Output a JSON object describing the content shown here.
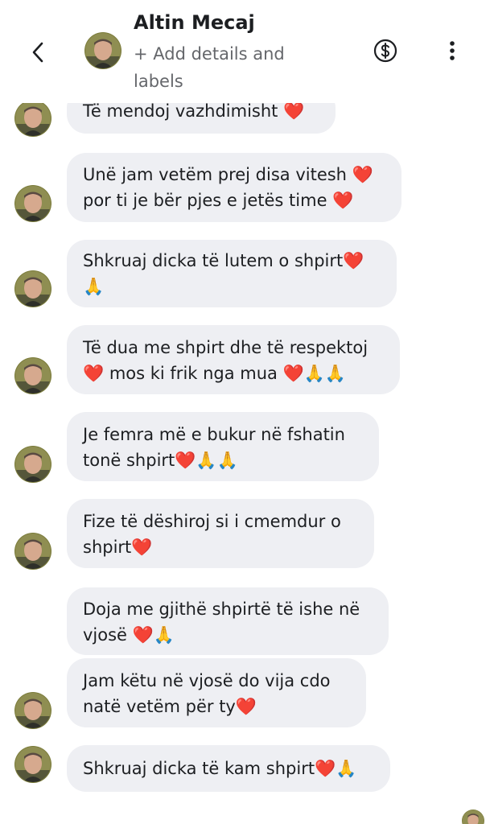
{
  "header": {
    "contact_name": "Altin Mecaj",
    "subtitle": "+ Add details and labels"
  },
  "icons": {
    "back": "chevron-left-icon",
    "payment": "dollar-circle-icon",
    "more": "vertical-ellipsis-icon"
  },
  "messages": [
    {
      "text": "Të mendoj vazhdimisht ❤️"
    },
    {
      "text": "Unë jam vetëm prej disa vitesh ❤️ por ti je bër pjes e jetës time ❤️"
    },
    {
      "text": "Shkruaj dicka të lutem o shpirt❤️ 🙏"
    },
    {
      "text": "Të dua me shpirt dhe të respektoj ❤️ mos ki frik nga mua ❤️🙏🙏"
    },
    {
      "text": "Je femra më e bukur në fshatin tonë shpirt❤️🙏🙏"
    },
    {
      "text": "Fize të dëshiroj si i cmemdur o shpirt❤️"
    },
    {
      "text": "Doja me gjithë shpirtë të ishe në vjosë ❤️🙏"
    },
    {
      "text": "Jam këtu në vjosë do vija cdo natë vetëm për ty❤️"
    },
    {
      "text": "Shkruaj dicka të kam shpirt❤️🙏"
    }
  ],
  "colors": {
    "bubble_bg": "#eeeff3",
    "text": "#1c1e21",
    "secondary_text": "#65676b",
    "heart": "#e0242f"
  }
}
